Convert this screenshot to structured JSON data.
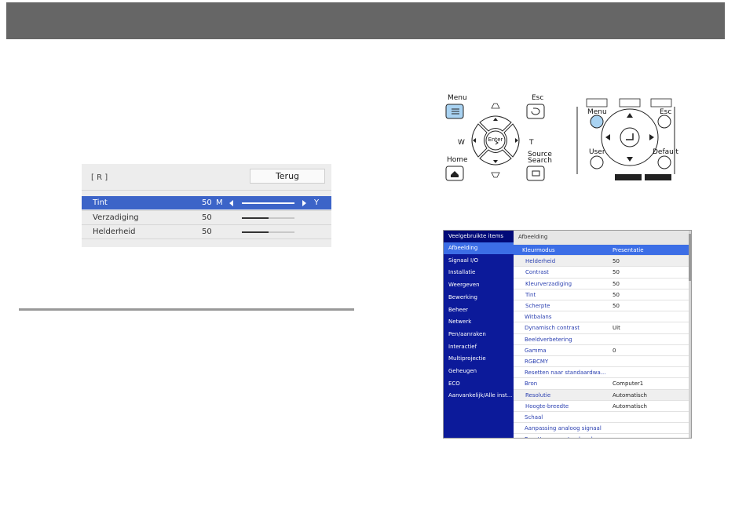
{
  "adjust_panel": {
    "region_label": "[ R ]",
    "back_button": "Terug",
    "rows": [
      {
        "name": "Tint",
        "value": "50",
        "left_label": "M",
        "right_label": "Y",
        "level_pct": 50,
        "selected": true
      },
      {
        "name": "Verzadiging",
        "value": "50",
        "level_pct": 50,
        "selected": false
      },
      {
        "name": "Helderheid",
        "value": "50",
        "level_pct": 50,
        "selected": false
      }
    ]
  },
  "remote_left": {
    "menu": "Menu",
    "esc": "Esc",
    "home": "Home",
    "source_search_1": "Source",
    "source_search_2": "Search",
    "enter": "Enter",
    "w": "W",
    "t": "T"
  },
  "remote_right": {
    "menu": "Menu",
    "esc": "Esc",
    "user": "User",
    "default": "Default"
  },
  "menu": {
    "sidebar": [
      "Veelgebruikte items",
      "Afbeelding",
      "Signaal I/O",
      "Installatie",
      "Weergeven",
      "Bewerking",
      "Beheer",
      "Netwerk",
      "Pen/aanraken",
      "Interactief",
      "Multiprojectie",
      "Geheugen",
      "ECO",
      "Aanvankelijk/Alle inst..."
    ],
    "header": "Afbeelding",
    "items": [
      {
        "label": "Kleurmodus",
        "value": "Presentatie"
      },
      {
        "label": "Helderheid",
        "value": "50"
      },
      {
        "label": "Contrast",
        "value": "50"
      },
      {
        "label": "Kleurverzadiging",
        "value": "50"
      },
      {
        "label": "Tint",
        "value": "50"
      },
      {
        "label": "Scherpte",
        "value": "50"
      },
      {
        "label": "Witbalans",
        "value": ""
      },
      {
        "label": "Dynamisch contrast",
        "value": "Uit"
      },
      {
        "label": "Beeldverbetering",
        "value": ""
      },
      {
        "label": "Gamma",
        "value": "0"
      },
      {
        "label": "RGBCMY",
        "value": ""
      },
      {
        "label": "Resetten naar standaardwa...",
        "value": ""
      },
      {
        "label": "Bron",
        "value": "Computer1"
      },
      {
        "label": "Resolutie",
        "value": "Automatisch"
      },
      {
        "label": "Hoogte-breedte",
        "value": "Automatisch"
      },
      {
        "label": "Schaal",
        "value": ""
      },
      {
        "label": "Aanpassing analoog signaal",
        "value": ""
      },
      {
        "label": "Resetten naar standaardwa...",
        "value": ""
      }
    ]
  },
  "colors": {
    "accent_blue": "#3c64c8",
    "menu_sidebar": "#0c1a9a",
    "menu_highlight": "#3c6ee6",
    "menu_button_fill": "#a9d3f2"
  }
}
